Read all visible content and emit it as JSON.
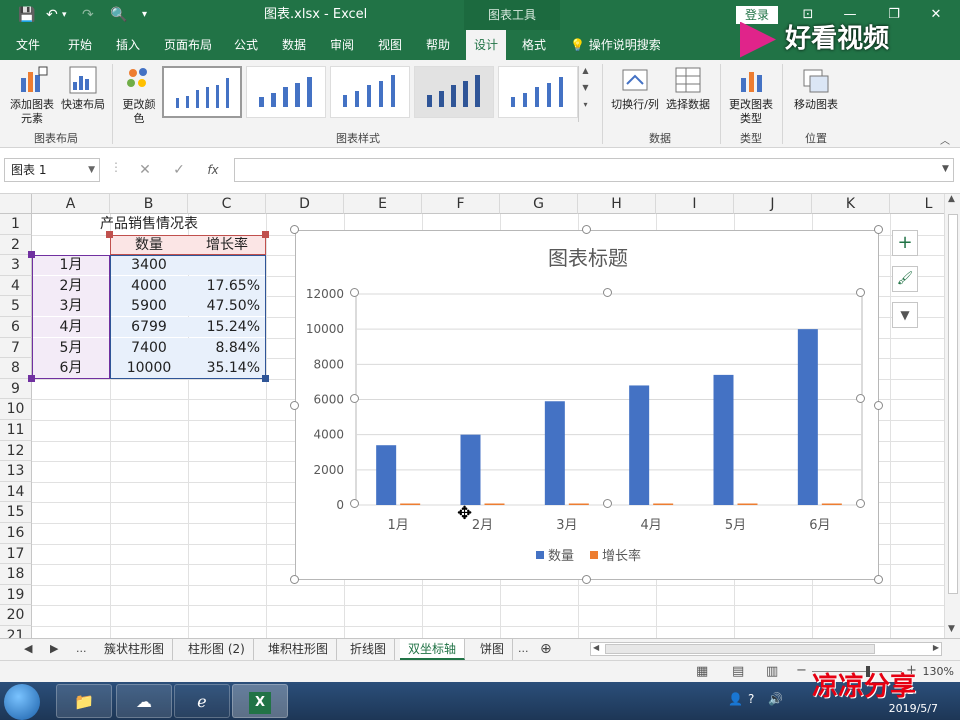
{
  "titlebar": {
    "doc_title": "图表.xlsx - Excel",
    "context_tools": "图表工具",
    "login": "登录",
    "customize_glyph": "≡"
  },
  "tabs": [
    {
      "label": "文件"
    },
    {
      "label": "开始"
    },
    {
      "label": "插入"
    },
    {
      "label": "页面布局"
    },
    {
      "label": "公式"
    },
    {
      "label": "数据"
    },
    {
      "label": "审阅"
    },
    {
      "label": "视图"
    },
    {
      "label": "帮助"
    },
    {
      "label": "设计"
    },
    {
      "label": "格式"
    }
  ],
  "tell_me": "操作说明搜索",
  "ribbon": {
    "add_element": "添加图表元素",
    "quick_layout": "快速布局",
    "group_layout": "图表布局",
    "change_color": "更改颜色",
    "group_styles": "图表样式",
    "switch_row_col": "切换行/列",
    "select_data": "选择数据",
    "group_data": "数据",
    "change_type": "更改图表类型",
    "group_type": "类型",
    "move_chart": "移动图表",
    "group_location": "位置"
  },
  "formula": {
    "name_box": "图表 1",
    "cancel": "✕",
    "confirm": "✓",
    "fx": "fx",
    "value": ""
  },
  "grid": {
    "columns": [
      "A",
      "B",
      "C",
      "D",
      "E",
      "F",
      "G",
      "H",
      "I",
      "J",
      "K",
      "L"
    ],
    "rows": [
      "1",
      "2",
      "3",
      "4",
      "5",
      "6",
      "7",
      "8",
      "9",
      "10",
      "11",
      "12",
      "13",
      "14",
      "15",
      "16",
      "17",
      "18",
      "19",
      "20",
      "21"
    ],
    "table_title": "产品销售情况表",
    "header_qty": "数量",
    "header_rate": "增长率",
    "data": [
      {
        "month": "1月",
        "qty": "3400",
        "rate": ""
      },
      {
        "month": "2月",
        "qty": "4000",
        "rate": "17.65%"
      },
      {
        "month": "3月",
        "qty": "5900",
        "rate": "47.50%"
      },
      {
        "month": "4月",
        "qty": "6799",
        "rate": "15.24%"
      },
      {
        "month": "5月",
        "qty": "7400",
        "rate": "8.84%"
      },
      {
        "month": "6月",
        "qty": "10000",
        "rate": "35.14%"
      }
    ]
  },
  "chart_data": {
    "type": "bar",
    "title": "图表标题",
    "categories": [
      "1月",
      "2月",
      "3月",
      "4月",
      "5月",
      "6月"
    ],
    "series": [
      {
        "name": "数量",
        "values": [
          3400,
          4000,
          5900,
          6799,
          7400,
          10000
        ],
        "color": "#4472c4"
      },
      {
        "name": "增长率",
        "values": [
          0,
          0.1765,
          0.475,
          0.1524,
          0.0884,
          0.3514
        ],
        "color": "#ed7d31"
      }
    ],
    "yticks": [
      "0",
      "2000",
      "4000",
      "6000",
      "8000",
      "10000",
      "12000"
    ],
    "ylim": [
      0,
      12000
    ],
    "grid": true,
    "legend": "bottom"
  },
  "chart_buttons": {
    "add": "+",
    "style": "🖌",
    "filter": "▼"
  },
  "sheets": {
    "nav_prev": "◀",
    "nav_next": "▶",
    "more": "...",
    "tabs": [
      "簇状柱形图",
      "柱形图 (2)",
      "堆积柱形图",
      "折线图",
      "双坐标轴",
      "饼图"
    ],
    "active": "双坐标轴",
    "add": "⊕"
  },
  "status": {
    "zoom": "130%"
  },
  "taskbar": {
    "date": "2019/5/7",
    "time_partial": "22"
  },
  "watermark": {
    "logo_text": "好看视频",
    "corner_text": "凉凉分享"
  }
}
